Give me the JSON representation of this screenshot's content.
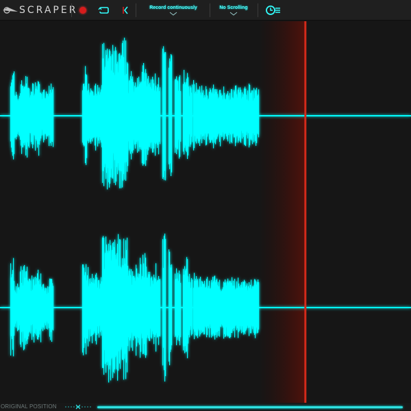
{
  "app": {
    "title": "SCRAPER"
  },
  "toolbar": {
    "record_button": "record",
    "loop_button": "loop",
    "back_button": "back",
    "record_mode": "Record continuously",
    "scroll_mode": "No Scrolling",
    "settings_button": "settings"
  },
  "footer": {
    "original_position_label": "ORIGINAL POSITION",
    "position_fraction": 0.99
  },
  "colors": {
    "waveform": "#00ffff",
    "background": "#161616",
    "playhead": "#d42a1a",
    "record_dot": "#d71c1c"
  },
  "icons": [
    "scraper-logo-icon",
    "record-icon",
    "loop-icon",
    "back-icon",
    "chevron-down-icon",
    "settings-icon"
  ],
  "waveform": {
    "channels": 2,
    "playhead_position": 0.743,
    "fade_start_position": 0.63,
    "segments": [
      {
        "from": 0.025,
        "to": 0.035,
        "amp": 0.62
      },
      {
        "from": 0.035,
        "to": 0.048,
        "amp": 0.3
      },
      {
        "from": 0.048,
        "to": 0.07,
        "amp": 0.52
      },
      {
        "from": 0.07,
        "to": 0.082,
        "amp": 0.4
      },
      {
        "from": 0.082,
        "to": 0.1,
        "amp": 0.48
      },
      {
        "from": 0.1,
        "to": 0.118,
        "amp": 0.32
      },
      {
        "from": 0.118,
        "to": 0.13,
        "amp": 0.42
      },
      {
        "from": 0.2,
        "to": 0.215,
        "amp": 0.6
      },
      {
        "from": 0.215,
        "to": 0.235,
        "amp": 0.45
      },
      {
        "from": 0.235,
        "to": 0.25,
        "amp": 0.38
      },
      {
        "from": 0.248,
        "to": 0.268,
        "amp": 0.95
      },
      {
        "from": 0.268,
        "to": 0.29,
        "amp": 0.88
      },
      {
        "from": 0.29,
        "to": 0.312,
        "amp": 0.92
      },
      {
        "from": 0.312,
        "to": 0.33,
        "amp": 0.55
      },
      {
        "from": 0.33,
        "to": 0.345,
        "amp": 0.6
      },
      {
        "from": 0.345,
        "to": 0.358,
        "amp": 0.65
      },
      {
        "from": 0.358,
        "to": 0.372,
        "amp": 0.5
      },
      {
        "from": 0.372,
        "to": 0.39,
        "amp": 0.55
      },
      {
        "from": 0.395,
        "to": 0.403,
        "amp": 0.9
      },
      {
        "from": 0.41,
        "to": 0.418,
        "amp": 0.82
      },
      {
        "from": 0.425,
        "to": 0.44,
        "amp": 0.52
      },
      {
        "from": 0.445,
        "to": 0.458,
        "amp": 0.6
      },
      {
        "from": 0.458,
        "to": 0.468,
        "amp": 0.45
      },
      {
        "from": 0.47,
        "to": 0.48,
        "amp": 0.45
      },
      {
        "from": 0.475,
        "to": 0.63,
        "amp": 0.38
      }
    ]
  }
}
